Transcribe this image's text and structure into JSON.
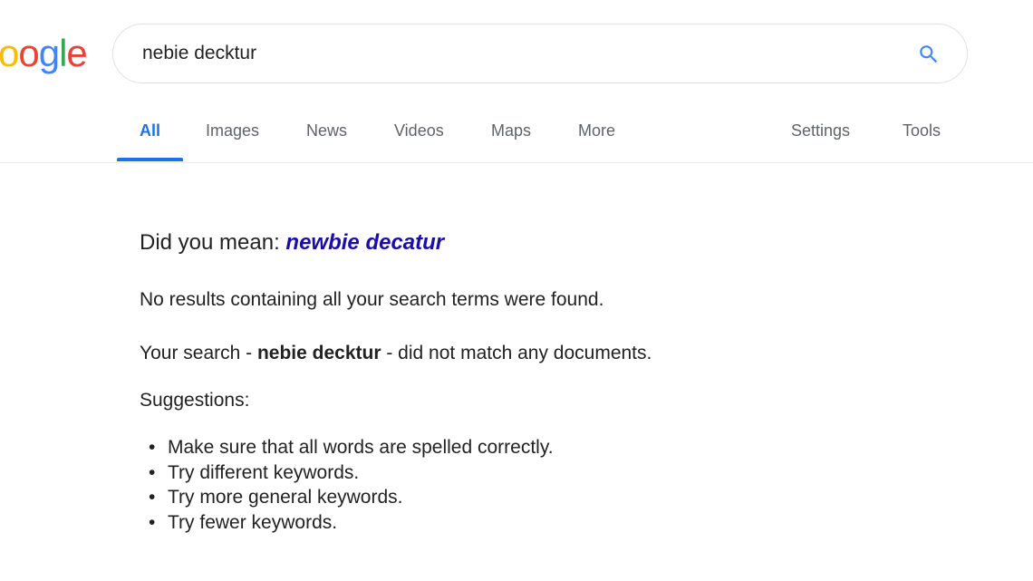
{
  "logo": {
    "letters": [
      "o",
      "o",
      "g",
      "l",
      "e"
    ],
    "colors": [
      "#fbbc05",
      "#4285f4",
      "#34a853",
      "#4285f4",
      "#ea4335"
    ]
  },
  "search": {
    "query": "nebie decktur",
    "icon": "search-icon",
    "icon_color": "#4285f4"
  },
  "tabs": [
    {
      "label": "All",
      "active": true
    },
    {
      "label": "Images",
      "active": false
    },
    {
      "label": "News",
      "active": false
    },
    {
      "label": "Videos",
      "active": false
    },
    {
      "label": "Maps",
      "active": false
    },
    {
      "label": "More",
      "active": false
    },
    {
      "label": "Settings",
      "active": false
    },
    {
      "label": "Tools",
      "active": false
    }
  ],
  "results": {
    "did_you_mean_prefix": "Did you mean:",
    "did_you_mean_suggestion": "newbie decatur",
    "no_results": "No results containing all your search terms were found.",
    "your_search_prefix": "Your search -",
    "your_search_query": "nebie decktur",
    "your_search_suffix": "- did not match any documents.",
    "suggestions_label": "Suggestions:",
    "suggestions": [
      "Make sure that all words are spelled correctly.",
      "Try different keywords.",
      "Try more general keywords.",
      "Try fewer keywords."
    ]
  },
  "colors": {
    "accent": "#1a73e8",
    "link": "#1a0dab",
    "tab_text": "#5f6368"
  }
}
